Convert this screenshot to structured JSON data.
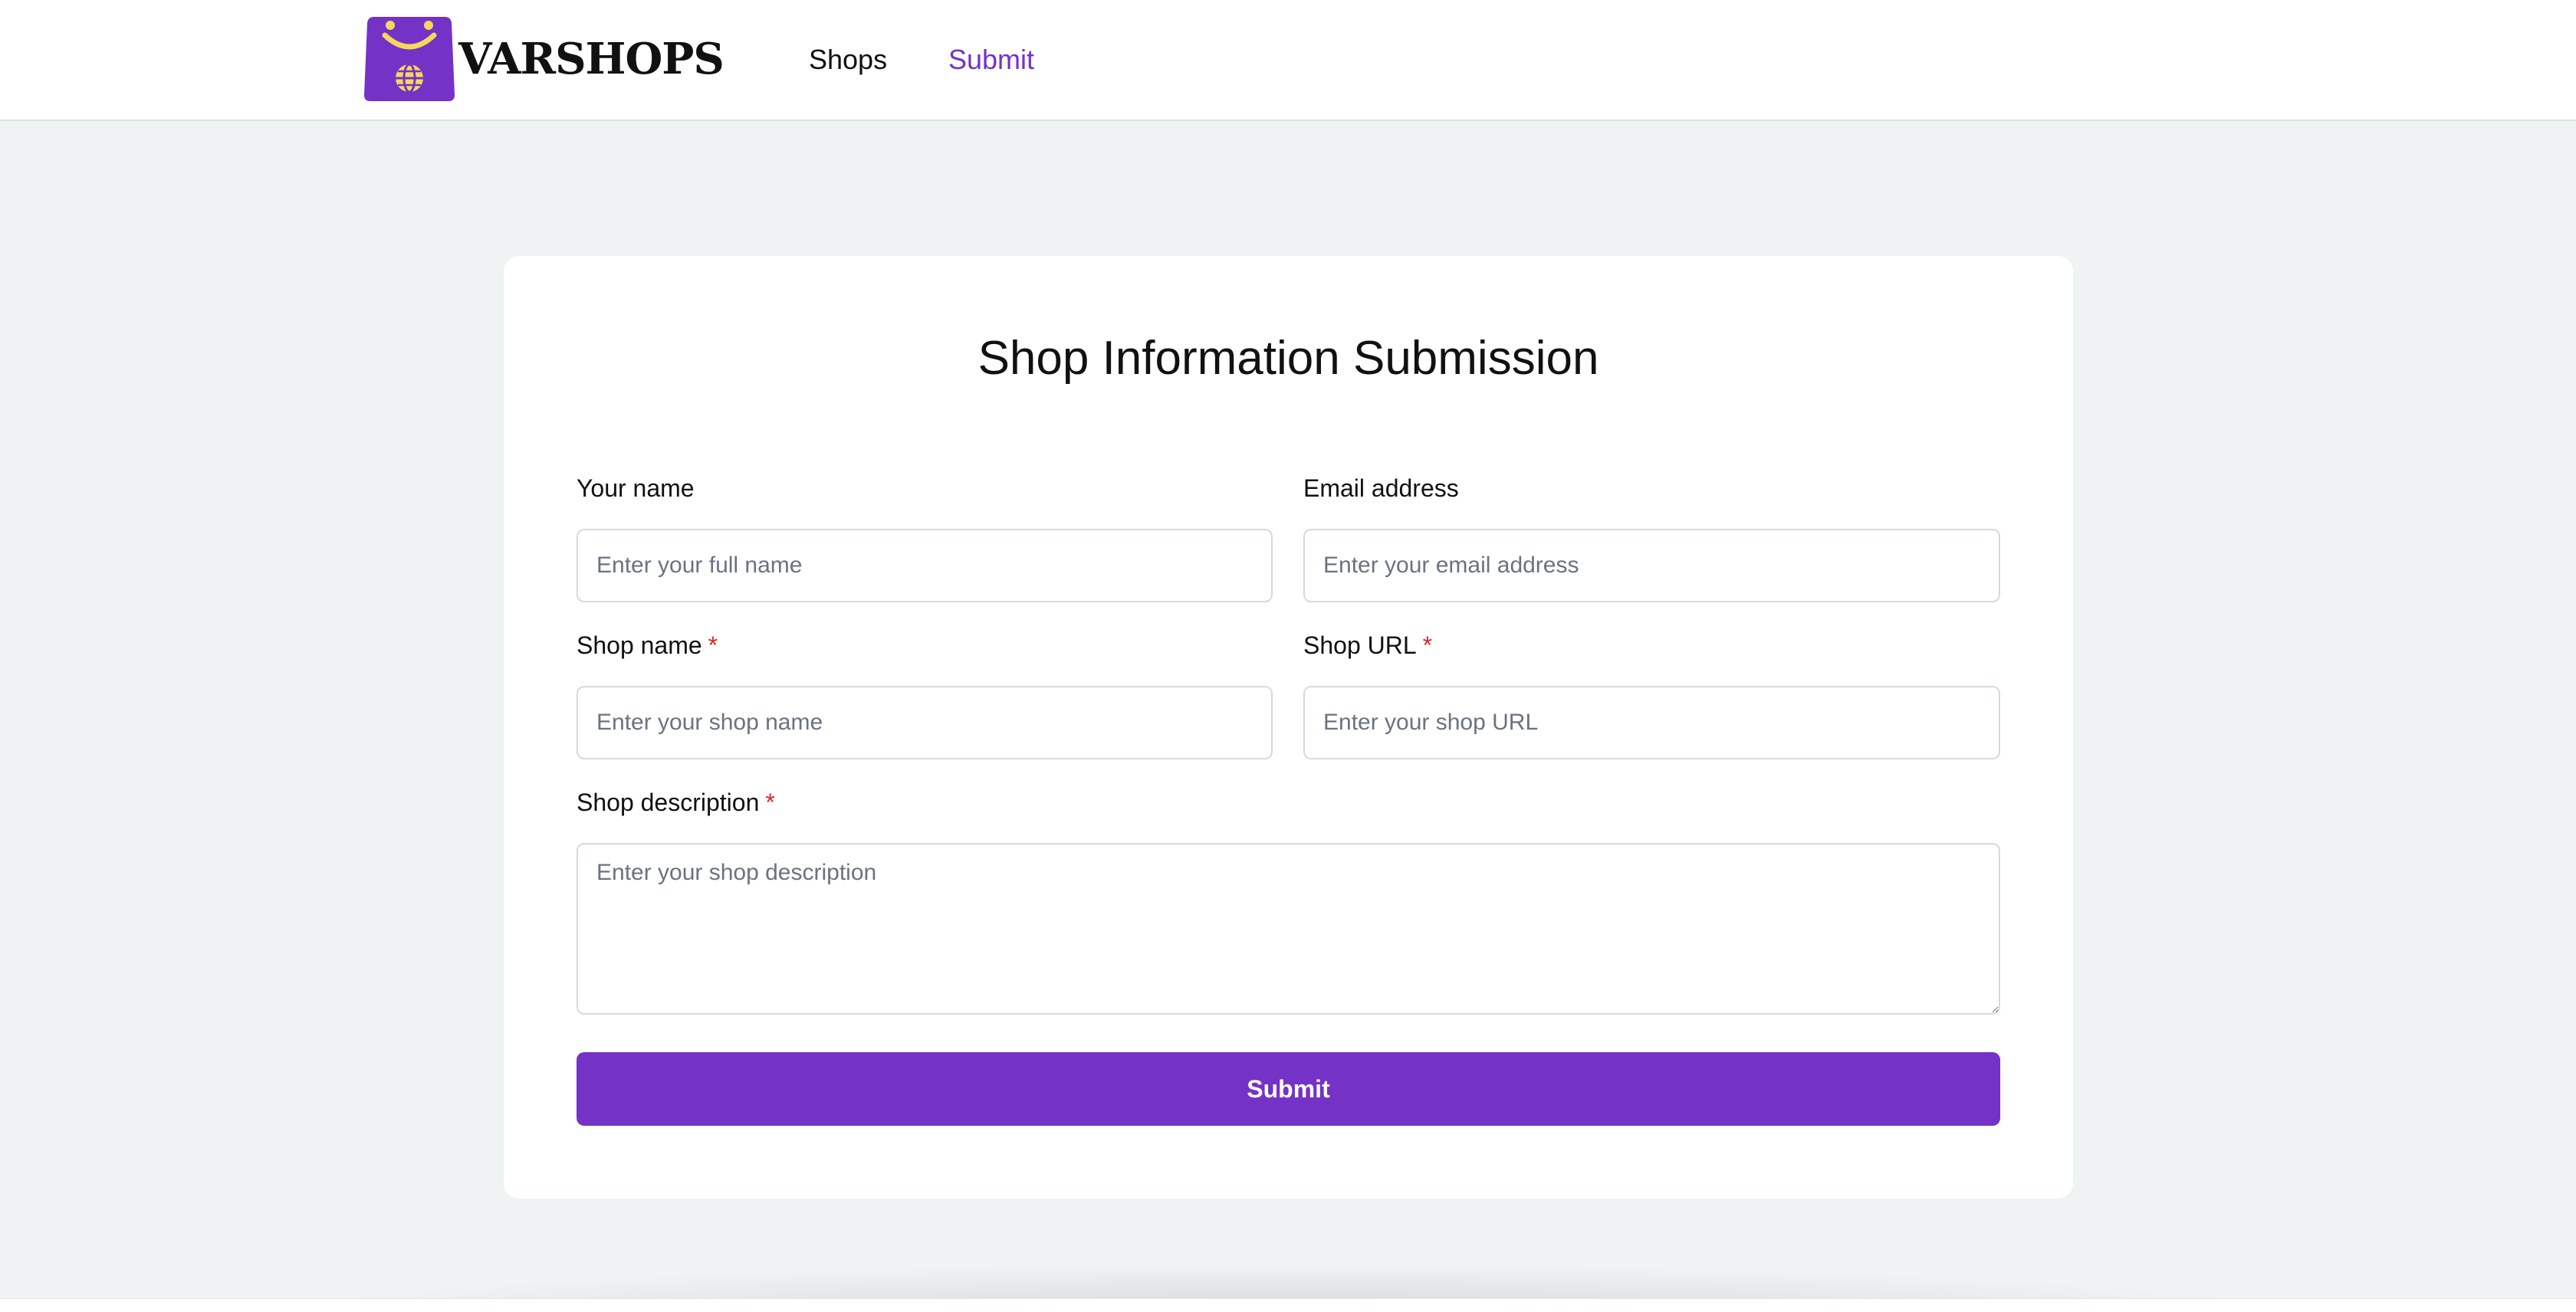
{
  "header": {
    "brand": "VARSHOPS",
    "nav": [
      {
        "label": "Shops"
      },
      {
        "label": "Submit"
      }
    ]
  },
  "form": {
    "title": "Shop Information Submission",
    "fields": {
      "name": {
        "label": "Your name",
        "placeholder": "Enter your full name",
        "value": ""
      },
      "email": {
        "label": "Email address",
        "placeholder": "Enter your email address",
        "value": ""
      },
      "shop_name": {
        "label": "Shop name",
        "required_mark": "*",
        "placeholder": "Enter your shop name",
        "value": ""
      },
      "shop_url": {
        "label": "Shop URL",
        "required_mark": "*",
        "placeholder": "Enter your shop URL",
        "value": ""
      },
      "shop_description": {
        "label": "Shop description",
        "required_mark": "*",
        "placeholder": "Enter your shop description",
        "value": ""
      }
    },
    "submit_label": "Submit"
  },
  "colors": {
    "brand_purple": "#7432c6",
    "logo_yellow": "#f5d75a",
    "required_red": "#dc2626",
    "page_background": "#f0f3f3"
  },
  "icons": {
    "logo": "shopping-bag-smiley-globe-icon"
  }
}
